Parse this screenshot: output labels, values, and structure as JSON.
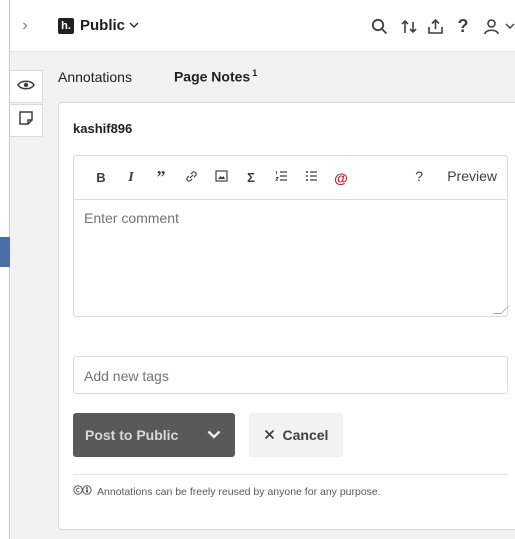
{
  "topbar": {
    "group_name": "Public",
    "logo_text": "h.",
    "icons": [
      "search-icon",
      "sort-icon",
      "share-icon",
      "help-icon",
      "user-icon"
    ]
  },
  "tabs": {
    "annotations": "Annotations",
    "page_notes": "Page Notes",
    "page_notes_count": "1"
  },
  "card": {
    "username": "kashif896",
    "toolbar": {
      "bold": "B",
      "italic": "I",
      "quote": "”",
      "math": "Σ",
      "help": "?",
      "preview": "Preview"
    },
    "comment_placeholder": "Enter comment",
    "tags_placeholder": "Add new tags",
    "post_label": "Post to Public",
    "cancel_label": "Cancel",
    "license_text": "Annotations can be freely reused by anyone for any purpose."
  },
  "colors": {
    "accent_red": "#bd1c2b",
    "post_button_bg": "#595959"
  }
}
